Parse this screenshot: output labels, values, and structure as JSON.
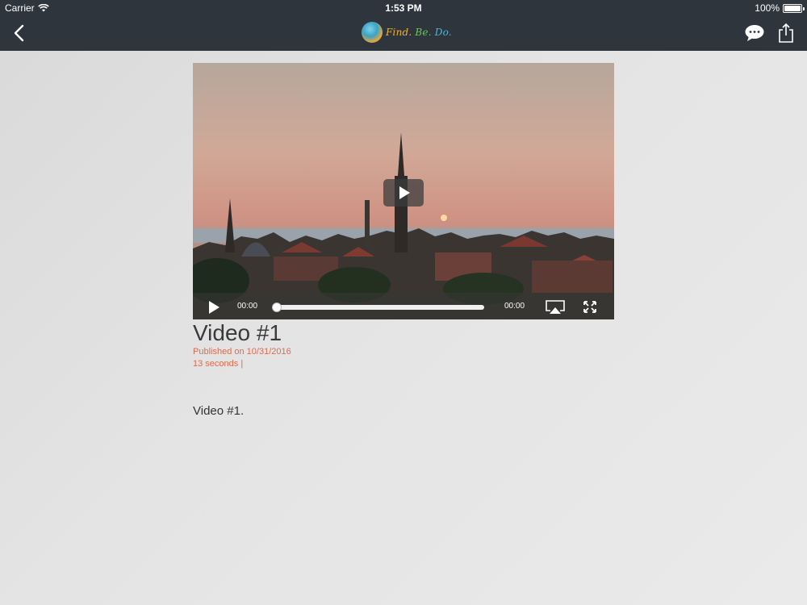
{
  "status_bar": {
    "carrier": "Carrier",
    "time": "1:53 PM",
    "battery": "100%",
    "battery_level": 1.0
  },
  "nav": {
    "back_icon": "chevron-left-icon",
    "logo": {
      "word1": "Find.",
      "word2": "Be.",
      "word3": "Do."
    },
    "chat_icon": "speech-bubble-icon",
    "share_icon": "share-icon"
  },
  "video": {
    "current_time": "00:00",
    "duration": "00:00",
    "progress": 0.0,
    "play_icon": "play-icon",
    "airplay_icon": "airplay-icon",
    "fullscreen_icon": "fullscreen-icon"
  },
  "article": {
    "title": "Video #1",
    "published": "Published on 10/31/2016",
    "length": "13 seconds |",
    "description": "Video #1."
  },
  "colors": {
    "nav_bg": "#2f353d",
    "meta_text": "#e06a4a",
    "page_bg": "#e2e2e2"
  }
}
